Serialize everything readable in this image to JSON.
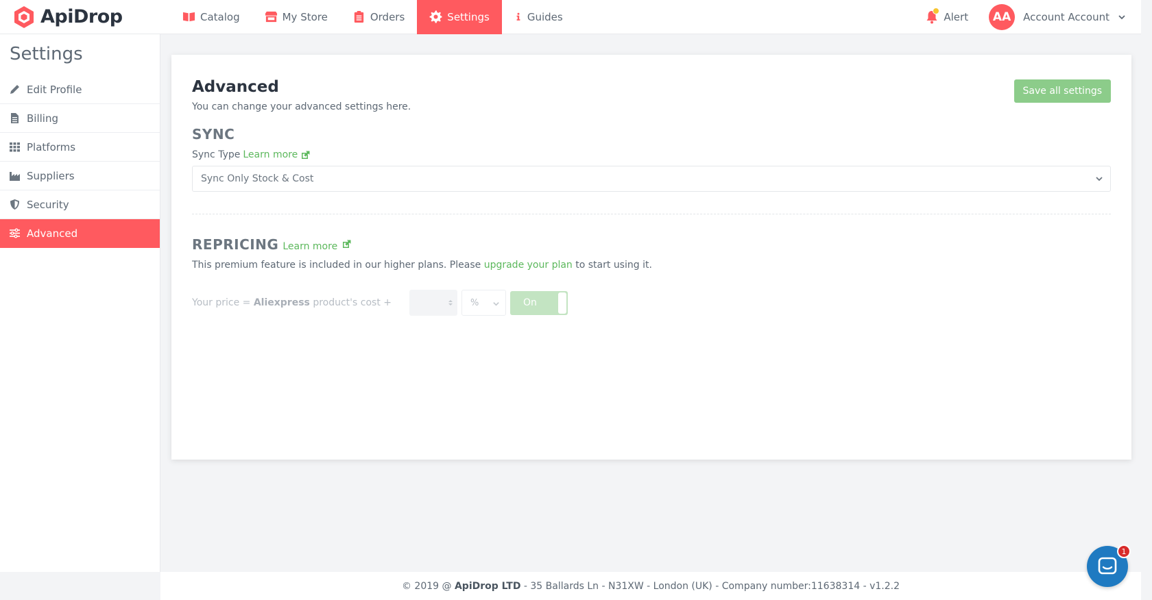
{
  "app": {
    "brand": "ApiDrop",
    "accent_color": "#ff5a5f",
    "success_color": "#8ccc8a"
  },
  "nav": {
    "items": [
      {
        "label": "Catalog",
        "icon": "book-icon"
      },
      {
        "label": "My Store",
        "icon": "store-icon"
      },
      {
        "label": "Orders",
        "icon": "clipboard-icon"
      },
      {
        "label": "Settings",
        "icon": "gear-icon",
        "active": true
      },
      {
        "label": "Guides",
        "icon": "info-icon"
      }
    ],
    "alert_label": "Alert",
    "account_initials": "AA",
    "account_name": "Account Account"
  },
  "sidebar": {
    "title": "Settings",
    "items": [
      {
        "label": "Edit Profile",
        "icon": "pencil-icon"
      },
      {
        "label": "Billing",
        "icon": "document-icon"
      },
      {
        "label": "Platforms",
        "icon": "grid-icon"
      },
      {
        "label": "Suppliers",
        "icon": "factory-icon"
      },
      {
        "label": "Security",
        "icon": "shield-icon"
      },
      {
        "label": "Advanced",
        "icon": "sliders-icon",
        "active": true
      }
    ]
  },
  "main": {
    "title": "Advanced",
    "subtitle": "You can change your advanced settings here.",
    "save_label": "Save all settings",
    "sync": {
      "title": "SYNC",
      "field_label": "Sync Type",
      "learn_more": "Learn more",
      "selected": "Sync Only Stock & Cost"
    },
    "repricing": {
      "title": "REPRICING",
      "learn_more": "Learn more",
      "premium_prefix": "This premium feature is included in our higher plans. Please",
      "premium_link": "upgrade your plan",
      "premium_suffix": "to start using it.",
      "price_prefix": "Your price =",
      "price_supplier": "Aliexpress",
      "price_suffix": "product's cost +",
      "value": "",
      "unit": "%",
      "toggle_label": "On"
    }
  },
  "footer": {
    "prefix": "© 2019 @",
    "company": "ApiDrop LTD",
    "suffix": "- 35 Ballards Ln - N31XW - London (UK) - Company number:11638314 - v1.2.2"
  },
  "chat": {
    "badge": "1"
  }
}
